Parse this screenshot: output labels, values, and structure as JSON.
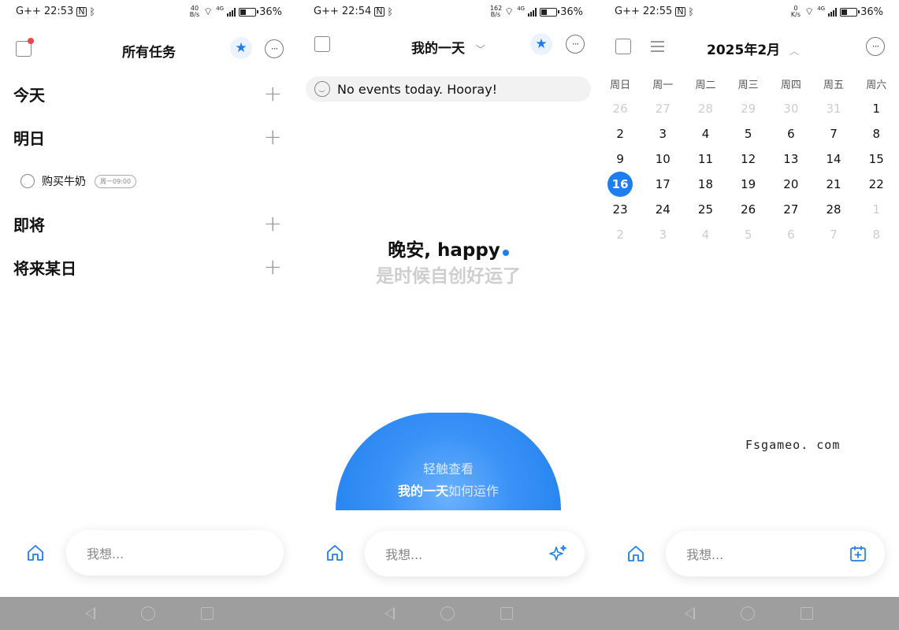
{
  "colors": {
    "accent": "#1e7ef0",
    "badge": "#e84a4a"
  },
  "panels": [
    {
      "status": {
        "carrier": "G++",
        "time": "22:53",
        "speed_top": "40",
        "speed_unit": "B/s",
        "network": "4G",
        "battery": "36%"
      },
      "header": {
        "title": "所有任务",
        "star_icon": "star-icon",
        "more_icon": "more-icon"
      },
      "sections": [
        {
          "title": "今天"
        },
        {
          "title": "明日"
        },
        {
          "title": "即将"
        },
        {
          "title": "将来某日"
        }
      ],
      "task": {
        "name": "购买牛奶",
        "tag": "周一09:00"
      },
      "input_placeholder": "我想..."
    },
    {
      "status": {
        "carrier": "G++",
        "time": "22:54",
        "speed_top": "162",
        "speed_unit": "B/s",
        "network": "4G",
        "battery": "36%"
      },
      "header": {
        "title": "我的一天"
      },
      "events_text": "No events today. Hooray!",
      "greeting": "晚安, happy",
      "greeting_sub": "是时候自创好运了",
      "dome_line1": "轻触查看",
      "dome_line2_bold": "我的一天",
      "dome_line2_rest": "如何运作",
      "input_placeholder": "我想..."
    },
    {
      "status": {
        "carrier": "G++",
        "time": "22:55",
        "speed_top": "0",
        "speed_unit": "K/s",
        "network": "4G",
        "battery": "36%"
      },
      "header": {
        "title": "2025年2月"
      },
      "weekdays": [
        "周日",
        "周一",
        "周二",
        "周三",
        "周四",
        "周五",
        "周六"
      ],
      "weeks": [
        [
          "26",
          "27",
          "28",
          "29",
          "30",
          "31",
          "1"
        ],
        [
          "2",
          "3",
          "4",
          "5",
          "6",
          "7",
          "8"
        ],
        [
          "9",
          "10",
          "11",
          "12",
          "13",
          "14",
          "15"
        ],
        [
          "16",
          "17",
          "18",
          "19",
          "20",
          "21",
          "22"
        ],
        [
          "23",
          "24",
          "25",
          "26",
          "27",
          "28",
          "1"
        ],
        [
          "2",
          "3",
          "4",
          "5",
          "6",
          "7",
          "8"
        ]
      ],
      "watermark": "Fsgameo. com",
      "input_placeholder": "我想..."
    }
  ]
}
